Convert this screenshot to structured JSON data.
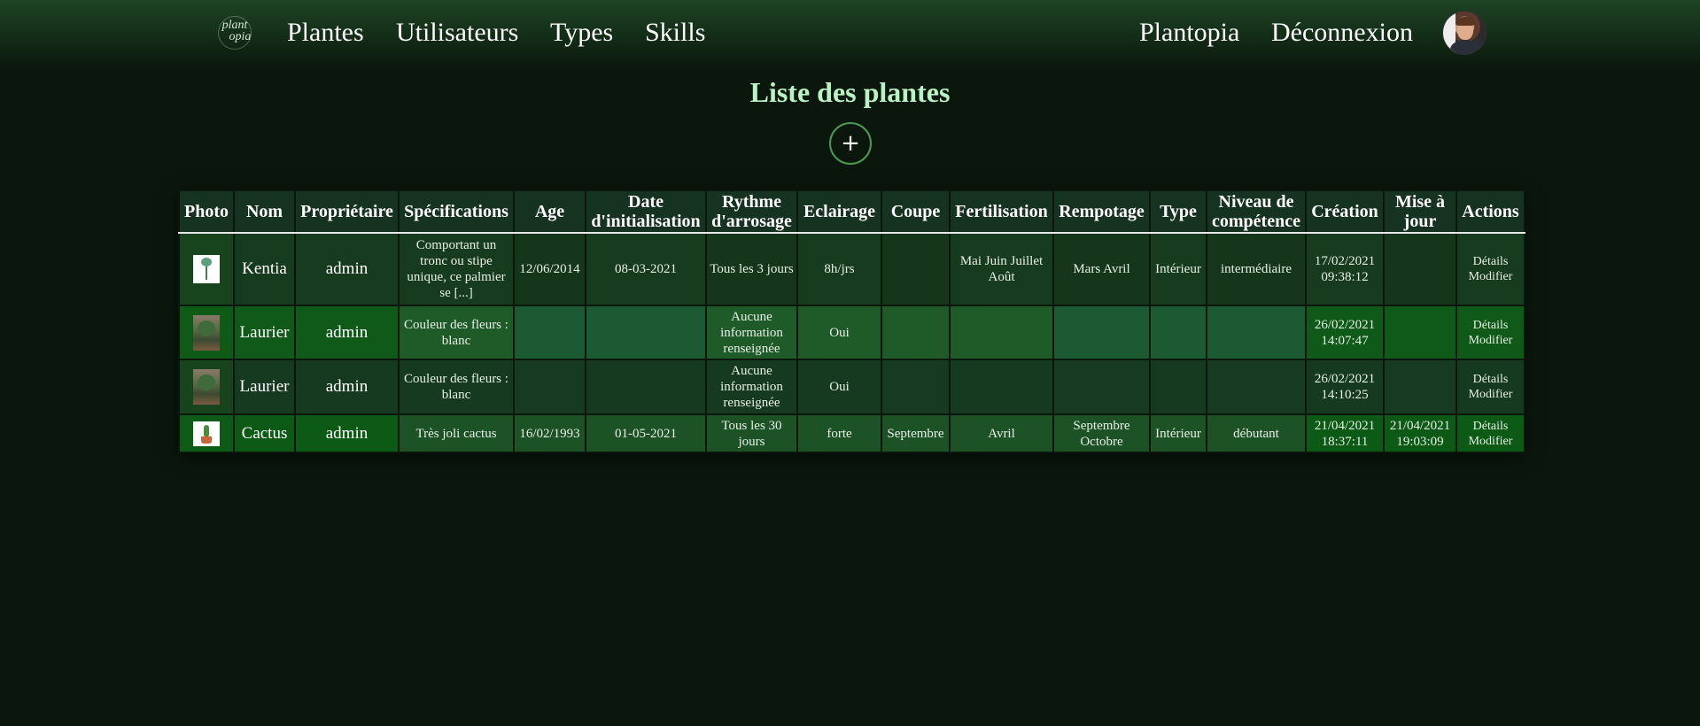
{
  "nav": {
    "logo_line1": "plant",
    "logo_line2": "opia",
    "links": [
      "Plantes",
      "Utilisateurs",
      "Types",
      "Skills"
    ],
    "right_links": [
      "Plantopia",
      "Déconnexion"
    ]
  },
  "page": {
    "title": "Liste des plantes",
    "add_label": "+"
  },
  "table": {
    "headers": [
      "Photo",
      "Nom",
      "Propriétaire",
      "Spécifications",
      "Age",
      "Date d'initialisation",
      "Rythme d'arrosage",
      "Eclairage",
      "Coupe",
      "Fertilisation",
      "Rempotage",
      "Type",
      "Niveau de compétence",
      "Création",
      "Mise à jour",
      "Actions"
    ],
    "rows": [
      {
        "photo_icon": "kentia-photo",
        "nom": "Kentia",
        "proprietaire": "admin",
        "specifications": "Comportant un tronc ou stipe unique, ce palmier se [...]",
        "age": "12/06/2014",
        "date_init": "08-03-2021",
        "arrosage": "Tous les 3 jours",
        "eclairage": "8h/jrs",
        "coupe": "",
        "fertilisation": "Mai Juin Juillet Août",
        "rempotage": "Mars Avril",
        "type": "Intérieur",
        "niveau": "intermédiaire",
        "creation": "17/02/2021 09:38:12",
        "mise_a_jour": "",
        "action_details": "Détails",
        "action_modifier": "Modifier"
      },
      {
        "photo_icon": "laurier-photo",
        "nom": "Laurier",
        "proprietaire": "admin",
        "specifications": "Couleur des fleurs : blanc",
        "age": "",
        "date_init": "",
        "arrosage": "Aucune information renseignée",
        "eclairage": "Oui",
        "coupe": "",
        "fertilisation": "",
        "rempotage": "",
        "type": "",
        "niveau": "",
        "creation": "26/02/2021 14:07:47",
        "mise_a_jour": "",
        "action_details": "Détails",
        "action_modifier": "Modifier"
      },
      {
        "photo_icon": "laurier-photo",
        "nom": "Laurier",
        "proprietaire": "admin",
        "specifications": "Couleur des fleurs : blanc",
        "age": "",
        "date_init": "",
        "arrosage": "Aucune information renseignée",
        "eclairage": "Oui",
        "coupe": "",
        "fertilisation": "",
        "rempotage": "",
        "type": "",
        "niveau": "",
        "creation": "26/02/2021 14:10:25",
        "mise_a_jour": "",
        "action_details": "Détails",
        "action_modifier": "Modifier"
      },
      {
        "photo_icon": "cactus-photo",
        "nom": "Cactus",
        "proprietaire": "admin",
        "specifications": "Très joli cactus",
        "age": "16/02/1993",
        "date_init": "01-05-2021",
        "arrosage": "Tous les 30 jours",
        "eclairage": "forte",
        "coupe": "Septembre",
        "fertilisation": "Avril",
        "rempotage": "Septembre Octobre",
        "type": "Intérieur",
        "niveau": "débutant",
        "creation": "21/04/2021 18:37:11",
        "mise_a_jour": "21/04/2021 19:03:09",
        "action_details": "Détails",
        "action_modifier": "Modifier"
      }
    ]
  },
  "colors": {
    "title": "#b9f3c3",
    "background": "#0b170d",
    "header_bg": "#163220",
    "add_border": "#4c9a52"
  }
}
